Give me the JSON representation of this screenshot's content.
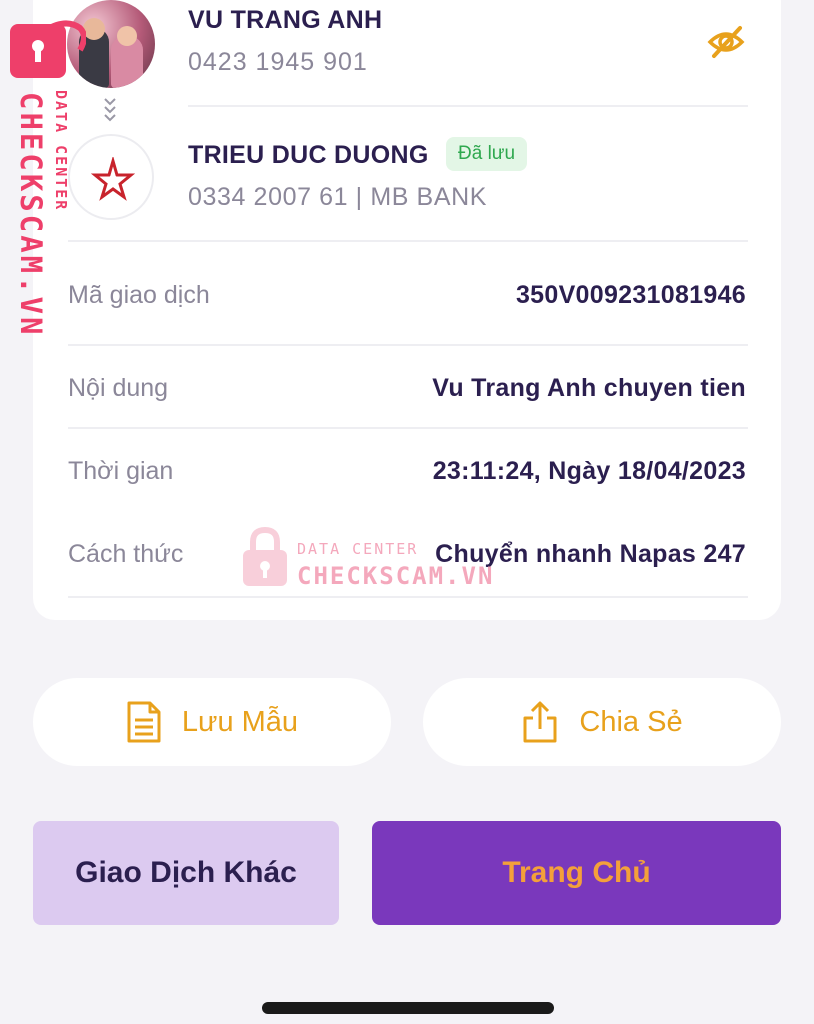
{
  "sender": {
    "name": "VU TRANG ANH",
    "account": "0423 1945 901"
  },
  "receiver": {
    "name": "TRIEU DUC DUONG",
    "saved_badge": "Đã lưu",
    "account": "0334 2007 61 | MB BANK"
  },
  "details": [
    {
      "label": "Mã giao dịch",
      "value": "350V009231081946"
    },
    {
      "label": "Nội dung",
      "value": "Vu Trang Anh chuyen tien"
    },
    {
      "label": "Thời gian",
      "value": "23:11:24, Ngày 18/04/2023"
    },
    {
      "label": "Cách thức",
      "value": "Chuyển nhanh Napas 247"
    }
  ],
  "actions": {
    "save_template": "Lưu Mẫu",
    "share": "Chia Sẻ",
    "other_transaction": "Giao Dịch Khác",
    "home": "Trang Chủ"
  },
  "watermark": {
    "side_big": "CHECKSCAM.VN",
    "side_small": "DATA CENTER",
    "center_small": "DATA CENTER",
    "center_big": "CHECKSCAM.VN"
  },
  "icons": {
    "hide_balance": "eye-off-icon",
    "bank_logo": "mb-bank-star-logo",
    "chevrons": "double-chevron-down-icon",
    "save_doc": "document-icon",
    "share": "share-upload-icon"
  },
  "colors": {
    "primary_purple": "#7a38bc",
    "light_purple": "#dccaf0",
    "accent_orange": "#e8a11c",
    "saved_green": "#2fa84f",
    "watermark_pink": "#ee3f6a"
  }
}
